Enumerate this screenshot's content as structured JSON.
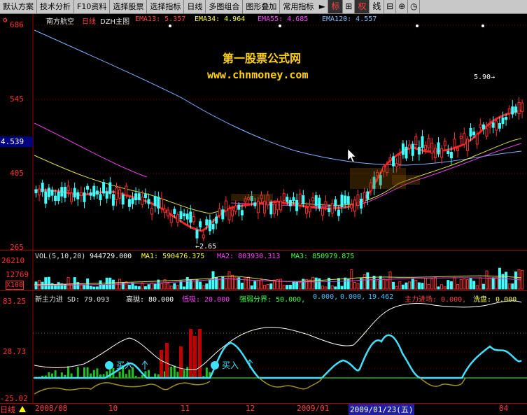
{
  "toolbar": {
    "items": [
      "默认方案",
      "技术分析",
      "F10资料",
      "选择股票",
      "选择指标",
      "日线",
      "多图组合",
      "图形叠加",
      "常用指标"
    ],
    "right_items": [
      "标",
      "权",
      "线"
    ]
  },
  "main_panel": {
    "stock_name": "南方航空",
    "period": "日线",
    "indicator_name": "DZH主图",
    "ema_labels": [
      {
        "text": "EMA13: 5.357",
        "color": "#ff4040"
      },
      {
        "text": "EMA34: 4.964",
        "color": "#ffff40"
      },
      {
        "text": "EMA55: 4.685",
        "color": "#ff40ff"
      },
      {
        "text": "EMA120: 4.557",
        "color": "#80c0ff"
      }
    ],
    "price_axis": [
      "686",
      "545",
      "405",
      "265"
    ],
    "current_price": "4.539",
    "watermark_title": "第一股票公式网",
    "watermark_url": "www.chnmoney.com",
    "low_marker": "2.65",
    "high_marker": "5.90"
  },
  "volume_panel": {
    "title": "VOL(5,10,20)",
    "values": [
      {
        "text": "944729.000",
        "color": "#ffffff"
      },
      {
        "text": "MA1: 590476.375",
        "color": "#ffff40"
      },
      {
        "text": "MA2: 803930.313",
        "color": "#ff40ff"
      },
      {
        "text": "MA3: 850979.875",
        "color": "#40ff40"
      }
    ],
    "axis": [
      "26210",
      "12769",
      "X100"
    ]
  },
  "indicator_panel": {
    "title": "新主力进 SD: 79.093",
    "items": [
      {
        "text": "高抛: 80.000",
        "color": "#ffffff"
      },
      {
        "text": "低吸: 20.000",
        "color": "#ff40ff"
      },
      {
        "text": "强弱分界: 50.000,",
        "color": "#40ff40"
      },
      {
        "text": "0.000,",
        "color": "#40c0ff"
      },
      {
        "text": "0.000,",
        "color": "#40c0ff"
      },
      {
        "text": "19.462",
        "color": "#40c0ff"
      },
      {
        "text": "主力进场: 0.000,",
        "color": "#ff4040"
      },
      {
        "text": "洗盘: 0.000",
        "color": "#ffff40"
      }
    ],
    "axis": [
      "83.25",
      "28.73",
      "-25.02"
    ],
    "buy_labels": [
      "买入",
      "买入"
    ]
  },
  "date_axis": {
    "period_label": "日线",
    "ticks": [
      "2008/08",
      "10",
      "11",
      "12",
      "2009/01",
      "2009/01/23(五)",
      "04"
    ]
  },
  "colors": {
    "ema13": "#ff2020",
    "ema34": "#e0e040",
    "ema55": "#e040e0",
    "ema120": "#80b0ff",
    "up": "#ff3030",
    "down": "#40ffff",
    "axis": "#ff3030",
    "grid": "#800000"
  }
}
